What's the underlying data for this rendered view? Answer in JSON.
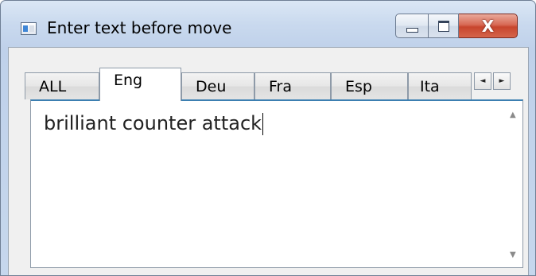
{
  "window": {
    "title": "Enter text before move",
    "icon": "app-window-icon",
    "caption_buttons": {
      "minimize_icon": "minimize-icon",
      "maximize_icon": "maximize-icon",
      "close_glyph": "X"
    }
  },
  "tabs": {
    "items": [
      {
        "label": "ALL"
      },
      {
        "label": "Eng"
      },
      {
        "label": "Deu"
      },
      {
        "label": "Fra"
      },
      {
        "label": "Esp"
      },
      {
        "label": "Ita"
      }
    ],
    "selected": "Eng",
    "scroll_left_glyph": "◄",
    "scroll_right_glyph": "►"
  },
  "editor": {
    "text": "brilliant counter attack",
    "scroll_up_glyph": "▲",
    "scroll_down_glyph": "▼"
  },
  "colors": {
    "accent": "#3c7fb1",
    "close_button": "#c7452d"
  }
}
